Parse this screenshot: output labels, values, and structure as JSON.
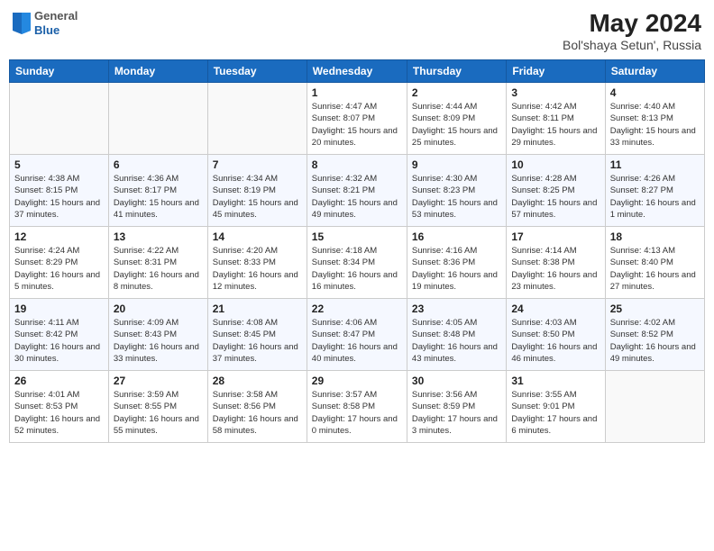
{
  "header": {
    "logo_general": "General",
    "logo_blue": "Blue",
    "main_title": "May 2024",
    "subtitle": "Bol'shaya Setun', Russia"
  },
  "days_of_week": [
    "Sunday",
    "Monday",
    "Tuesday",
    "Wednesday",
    "Thursday",
    "Friday",
    "Saturday"
  ],
  "weeks": [
    {
      "days": [
        {
          "number": "",
          "sunrise": "",
          "sunset": "",
          "daylight": ""
        },
        {
          "number": "",
          "sunrise": "",
          "sunset": "",
          "daylight": ""
        },
        {
          "number": "",
          "sunrise": "",
          "sunset": "",
          "daylight": ""
        },
        {
          "number": "1",
          "sunrise": "Sunrise: 4:47 AM",
          "sunset": "Sunset: 8:07 PM",
          "daylight": "Daylight: 15 hours and 20 minutes."
        },
        {
          "number": "2",
          "sunrise": "Sunrise: 4:44 AM",
          "sunset": "Sunset: 8:09 PM",
          "daylight": "Daylight: 15 hours and 25 minutes."
        },
        {
          "number": "3",
          "sunrise": "Sunrise: 4:42 AM",
          "sunset": "Sunset: 8:11 PM",
          "daylight": "Daylight: 15 hours and 29 minutes."
        },
        {
          "number": "4",
          "sunrise": "Sunrise: 4:40 AM",
          "sunset": "Sunset: 8:13 PM",
          "daylight": "Daylight: 15 hours and 33 minutes."
        }
      ]
    },
    {
      "days": [
        {
          "number": "5",
          "sunrise": "Sunrise: 4:38 AM",
          "sunset": "Sunset: 8:15 PM",
          "daylight": "Daylight: 15 hours and 37 minutes."
        },
        {
          "number": "6",
          "sunrise": "Sunrise: 4:36 AM",
          "sunset": "Sunset: 8:17 PM",
          "daylight": "Daylight: 15 hours and 41 minutes."
        },
        {
          "number": "7",
          "sunrise": "Sunrise: 4:34 AM",
          "sunset": "Sunset: 8:19 PM",
          "daylight": "Daylight: 15 hours and 45 minutes."
        },
        {
          "number": "8",
          "sunrise": "Sunrise: 4:32 AM",
          "sunset": "Sunset: 8:21 PM",
          "daylight": "Daylight: 15 hours and 49 minutes."
        },
        {
          "number": "9",
          "sunrise": "Sunrise: 4:30 AM",
          "sunset": "Sunset: 8:23 PM",
          "daylight": "Daylight: 15 hours and 53 minutes."
        },
        {
          "number": "10",
          "sunrise": "Sunrise: 4:28 AM",
          "sunset": "Sunset: 8:25 PM",
          "daylight": "Daylight: 15 hours and 57 minutes."
        },
        {
          "number": "11",
          "sunrise": "Sunrise: 4:26 AM",
          "sunset": "Sunset: 8:27 PM",
          "daylight": "Daylight: 16 hours and 1 minute."
        }
      ]
    },
    {
      "days": [
        {
          "number": "12",
          "sunrise": "Sunrise: 4:24 AM",
          "sunset": "Sunset: 8:29 PM",
          "daylight": "Daylight: 16 hours and 5 minutes."
        },
        {
          "number": "13",
          "sunrise": "Sunrise: 4:22 AM",
          "sunset": "Sunset: 8:31 PM",
          "daylight": "Daylight: 16 hours and 8 minutes."
        },
        {
          "number": "14",
          "sunrise": "Sunrise: 4:20 AM",
          "sunset": "Sunset: 8:33 PM",
          "daylight": "Daylight: 16 hours and 12 minutes."
        },
        {
          "number": "15",
          "sunrise": "Sunrise: 4:18 AM",
          "sunset": "Sunset: 8:34 PM",
          "daylight": "Daylight: 16 hours and 16 minutes."
        },
        {
          "number": "16",
          "sunrise": "Sunrise: 4:16 AM",
          "sunset": "Sunset: 8:36 PM",
          "daylight": "Daylight: 16 hours and 19 minutes."
        },
        {
          "number": "17",
          "sunrise": "Sunrise: 4:14 AM",
          "sunset": "Sunset: 8:38 PM",
          "daylight": "Daylight: 16 hours and 23 minutes."
        },
        {
          "number": "18",
          "sunrise": "Sunrise: 4:13 AM",
          "sunset": "Sunset: 8:40 PM",
          "daylight": "Daylight: 16 hours and 27 minutes."
        }
      ]
    },
    {
      "days": [
        {
          "number": "19",
          "sunrise": "Sunrise: 4:11 AM",
          "sunset": "Sunset: 8:42 PM",
          "daylight": "Daylight: 16 hours and 30 minutes."
        },
        {
          "number": "20",
          "sunrise": "Sunrise: 4:09 AM",
          "sunset": "Sunset: 8:43 PM",
          "daylight": "Daylight: 16 hours and 33 minutes."
        },
        {
          "number": "21",
          "sunrise": "Sunrise: 4:08 AM",
          "sunset": "Sunset: 8:45 PM",
          "daylight": "Daylight: 16 hours and 37 minutes."
        },
        {
          "number": "22",
          "sunrise": "Sunrise: 4:06 AM",
          "sunset": "Sunset: 8:47 PM",
          "daylight": "Daylight: 16 hours and 40 minutes."
        },
        {
          "number": "23",
          "sunrise": "Sunrise: 4:05 AM",
          "sunset": "Sunset: 8:48 PM",
          "daylight": "Daylight: 16 hours and 43 minutes."
        },
        {
          "number": "24",
          "sunrise": "Sunrise: 4:03 AM",
          "sunset": "Sunset: 8:50 PM",
          "daylight": "Daylight: 16 hours and 46 minutes."
        },
        {
          "number": "25",
          "sunrise": "Sunrise: 4:02 AM",
          "sunset": "Sunset: 8:52 PM",
          "daylight": "Daylight: 16 hours and 49 minutes."
        }
      ]
    },
    {
      "days": [
        {
          "number": "26",
          "sunrise": "Sunrise: 4:01 AM",
          "sunset": "Sunset: 8:53 PM",
          "daylight": "Daylight: 16 hours and 52 minutes."
        },
        {
          "number": "27",
          "sunrise": "Sunrise: 3:59 AM",
          "sunset": "Sunset: 8:55 PM",
          "daylight": "Daylight: 16 hours and 55 minutes."
        },
        {
          "number": "28",
          "sunrise": "Sunrise: 3:58 AM",
          "sunset": "Sunset: 8:56 PM",
          "daylight": "Daylight: 16 hours and 58 minutes."
        },
        {
          "number": "29",
          "sunrise": "Sunrise: 3:57 AM",
          "sunset": "Sunset: 8:58 PM",
          "daylight": "Daylight: 17 hours and 0 minutes."
        },
        {
          "number": "30",
          "sunrise": "Sunrise: 3:56 AM",
          "sunset": "Sunset: 8:59 PM",
          "daylight": "Daylight: 17 hours and 3 minutes."
        },
        {
          "number": "31",
          "sunrise": "Sunrise: 3:55 AM",
          "sunset": "Sunset: 9:01 PM",
          "daylight": "Daylight: 17 hours and 6 minutes."
        },
        {
          "number": "",
          "sunrise": "",
          "sunset": "",
          "daylight": ""
        }
      ]
    }
  ]
}
